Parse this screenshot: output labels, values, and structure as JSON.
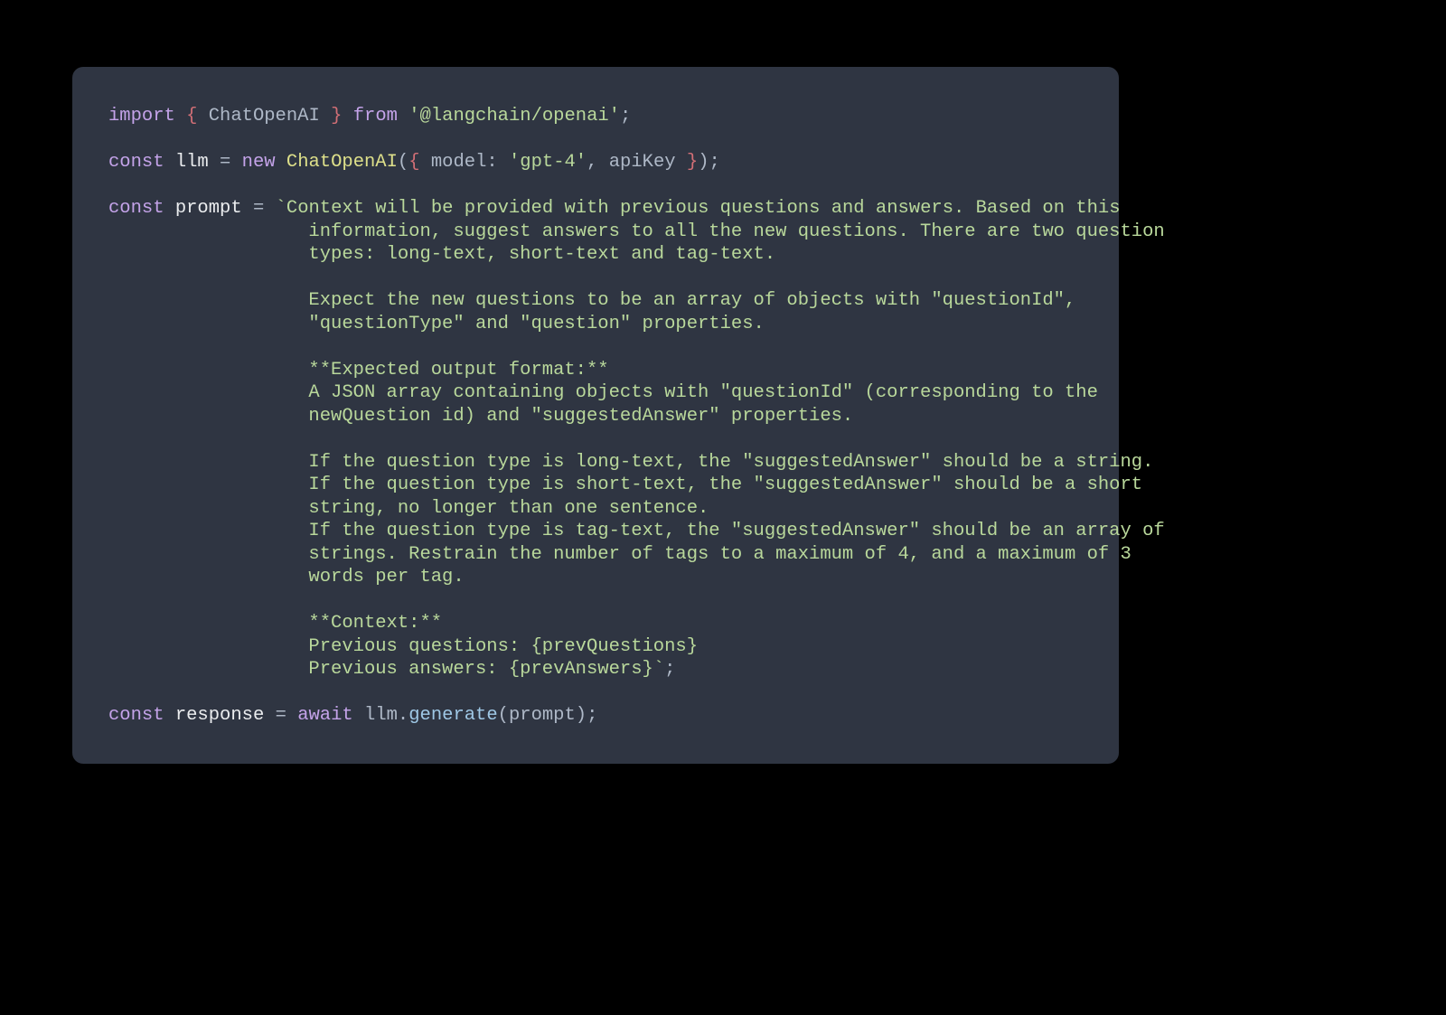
{
  "colors": {
    "background": "#000000",
    "panel": "#2f3542",
    "text_default": "#aeb8c7",
    "keyword": "#c4a3e9",
    "definition": "#ebedef",
    "class_name": "#dee08a",
    "string": "#b9d89b",
    "function": "#9fc8e6",
    "brace": "#d26f76"
  },
  "code": {
    "line1": {
      "import": "import",
      "lbrace": "{",
      "name": "ChatOpenAI",
      "rbrace": "}",
      "from": "from",
      "module": "'@langchain/openai'",
      "semi": ";"
    },
    "line3": {
      "const": "const",
      "var": "llm",
      "eq": "=",
      "new": "new",
      "cls": "ChatOpenAI",
      "lparen": "(",
      "lbrace": "{",
      "key1": "model",
      "colon1": ":",
      "val1": "'gpt-4'",
      "comma": ",",
      "key2": "apiKey",
      "rbrace": "}",
      "rparen": ")",
      "semi": ";"
    },
    "prompt_decl": {
      "const": "const",
      "var": "prompt",
      "eq": "=",
      "backtick_open": "`"
    },
    "prompt_body": {
      "p01": "Context will be provided with previous questions and answers. Based on this",
      "p02": "                  information, suggest answers to all the new questions. There are two question",
      "p03": "                  types: long-text, short-text and tag-text.",
      "p04": "",
      "p05": "                  Expect the new questions to be an array of objects with \"questionId\",",
      "p06": "                  \"questionType\" and \"question\" properties.",
      "p07": "",
      "p08": "                  **Expected output format:**",
      "p09": "                  A JSON array containing objects with \"questionId\" (corresponding to the",
      "p10": "                  newQuestion id) and \"suggestedAnswer\" properties.",
      "p11": "",
      "p12": "                  If the question type is long-text, the \"suggestedAnswer\" should be a string.",
      "p13": "                  If the question type is short-text, the \"suggestedAnswer\" should be a short",
      "p14": "                  string, no longer than one sentence.",
      "p15": "                  If the question type is tag-text, the \"suggestedAnswer\" should be an array of",
      "p16": "                  strings. Restrain the number of tags to a maximum of 4, and a maximum of 3",
      "p17": "                  words per tag.",
      "p18": "",
      "p19": "                  **Context:**",
      "p20": "                  Previous questions: {prevQuestions}",
      "p21": "                  Previous answers: {prevAnswers}"
    },
    "prompt_close": {
      "backtick_close": "`",
      "semi": ";"
    },
    "last": {
      "const": "const",
      "var": "response",
      "eq": "=",
      "await": "await",
      "obj": "llm",
      "dot": ".",
      "fn": "generate",
      "lparen": "(",
      "arg": "prompt",
      "rparen": ")",
      "semi": ";"
    }
  }
}
